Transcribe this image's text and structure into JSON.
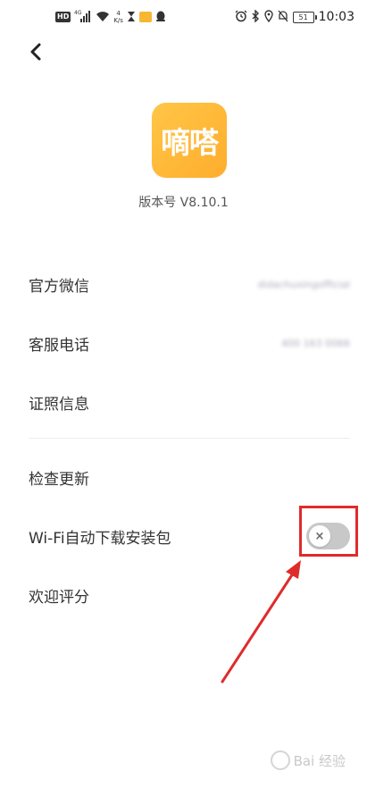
{
  "status_bar": {
    "network_badge": "HD",
    "network_type": "4G",
    "speed_value": "4",
    "speed_unit": "K/s",
    "battery": "51",
    "time": "10:03"
  },
  "header": {
    "back_icon": "chevron-left-icon"
  },
  "app": {
    "logo_text": "嘀嗒",
    "version": "版本号 V8.10.1",
    "brand_color": "#FFB52E"
  },
  "settings": {
    "official_wechat": {
      "label": "官方微信",
      "value": "didachuxingofficial"
    },
    "service_phone": {
      "label": "客服电话",
      "value": "400 163 0066"
    },
    "license_info": {
      "label": "证照信息"
    },
    "check_update": {
      "label": "检查更新"
    },
    "wifi_auto_download": {
      "label": "Wi-Fi自动下载安装包",
      "enabled": false,
      "toggle_symbol": "×"
    },
    "rate_us": {
      "label": "欢迎评分"
    }
  },
  "annotation": {
    "color": "#E02B2B"
  },
  "watermark": {
    "text": "Bai 经验"
  }
}
